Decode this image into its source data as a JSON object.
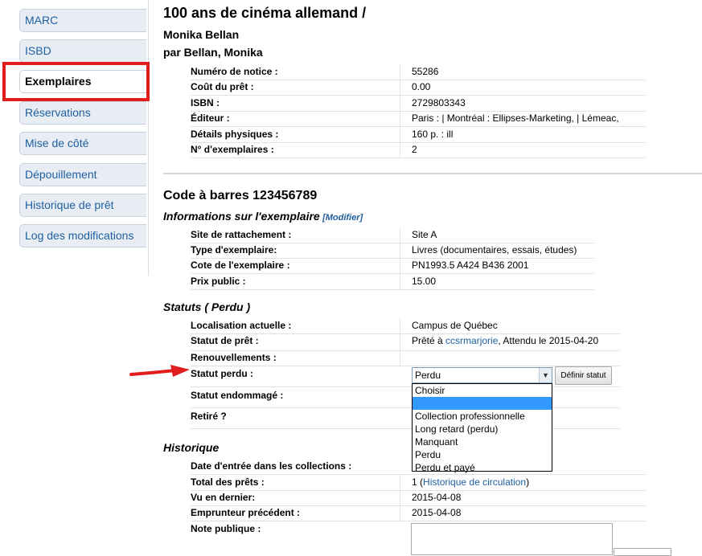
{
  "sidebar": {
    "tabs": [
      {
        "label": "MARC"
      },
      {
        "label": "ISBD"
      },
      {
        "label": "Exemplaires"
      },
      {
        "label": "Réservations"
      },
      {
        "label": "Mise de côté"
      },
      {
        "label": "Dépouillement"
      },
      {
        "label": "Historique de prêt"
      },
      {
        "label": "Log des modifications"
      }
    ]
  },
  "record": {
    "title": "100 ans de cinéma allemand /",
    "author_line": "Monika Bellan",
    "by_line": "par Bellan, Monika",
    "fields": [
      {
        "label": "Numéro de notice :",
        "value": "55286"
      },
      {
        "label": "Coût du prêt :",
        "value": "0.00"
      },
      {
        "label": "ISBN :",
        "value": "2729803343"
      },
      {
        "label": "Éditeur :",
        "value": "Paris : | Montréal : Ellipses-Marketing, | Lémeac,"
      },
      {
        "label": "Détails physiques :",
        "value": "160 p. : ill"
      },
      {
        "label": "N° d'exemplaires :",
        "value": "2"
      }
    ]
  },
  "item": {
    "barcode_heading": "Code à barres 123456789",
    "info_heading": "Informations sur l'exemplaire",
    "modify_link": "[Modifier]",
    "fields": [
      {
        "label": "Site de rattachement :",
        "value": "Site A"
      },
      {
        "label": "Type d'exemplaire:",
        "value": "Livres (documentaires, essais, études)"
      },
      {
        "label": "Cote de l'exemplaire :",
        "value": "PN1993.5 A424 B436 2001"
      },
      {
        "label": "Prix public :",
        "value": "15.00"
      }
    ]
  },
  "statuses": {
    "heading": "Statuts ( Perdu )",
    "location": {
      "label": "Localisation actuelle :",
      "value": "Campus de Québec"
    },
    "loan": {
      "label": "Statut de prêt :",
      "prefix": "Prêté à ",
      "user": "ccsrmarjorie",
      "suffix": ", Attendu le 2015-04-20"
    },
    "renewals": {
      "label": "Renouvellements :"
    },
    "lost": {
      "label": "Statut perdu :",
      "selected": "Perdu",
      "button": "Définir statut"
    },
    "damaged": {
      "label": "Statut endommagé :"
    },
    "withdrawn": {
      "label": "Retiré ?"
    },
    "lost_options": [
      "Choisir",
      "",
      "Collection professionnelle",
      "Long retard (perdu)",
      "Manquant",
      "Perdu",
      "Perdu et payé"
    ]
  },
  "history": {
    "heading": "Historique",
    "date_entry": {
      "label": "Date d'entrée dans les collections :"
    },
    "total_loans": {
      "label": "Total des prêts :",
      "value": "1",
      "link": "Historique de circulation"
    },
    "last_seen": {
      "label": "Vu en dernier:",
      "value": "2015-04-08"
    },
    "prev_borrower": {
      "label": "Emprunteur précédent :",
      "value": "2015-04-08"
    },
    "public_note": {
      "label": "Note publique :"
    }
  },
  "colors": {
    "accent": "#1f5fa0",
    "highlight": "#e21d1d",
    "selection": "#3399ff"
  }
}
